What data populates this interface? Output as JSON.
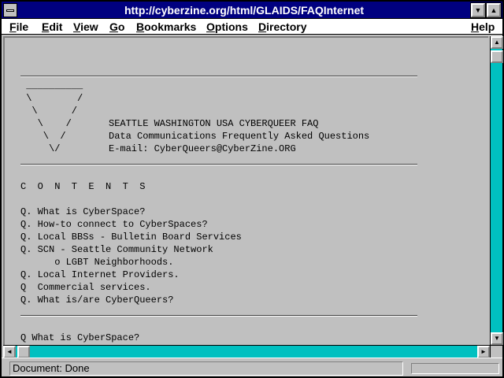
{
  "window": {
    "title": "http://cyberzine.org/html/GLAIDS/FAQInternet",
    "minimize_glyph": "▼",
    "maximize_glyph": "▲"
  },
  "menu": [
    {
      "label": "File",
      "underline": "F",
      "rest": "ile"
    },
    {
      "label": "Edit",
      "underline": "E",
      "rest": "dit"
    },
    {
      "label": "View",
      "underline": "V",
      "rest": "iew"
    },
    {
      "label": "Go",
      "underline": "G",
      "rest": "o"
    },
    {
      "label": "Bookmarks",
      "underline": "B",
      "rest": "ookmarks"
    },
    {
      "label": "Options",
      "underline": "O",
      "rest": "ptions"
    },
    {
      "label": "Directory",
      "underline": "D",
      "rest": "irectory"
    },
    {
      "label": "Help",
      "underline": "H",
      "rest": "elp"
    }
  ],
  "doc": {
    "logo_lines": [
      " __________",
      " \\        /",
      "  \\      /",
      "   \\    /",
      "    \\  /",
      "     \\/"
    ],
    "header_lines": [
      "SEATTLE WASHINGTON USA CYBERQUEER FAQ",
      "Data Communications Frequently Asked Questions",
      "E-mail: CyberQueers@CyberZine.ORG"
    ],
    "contents_heading": "C  O  N  T  E  N  T  S",
    "contents": [
      "Q. What is CyberSpace?",
      "Q. How-to connect to CyberSpaces?",
      "Q. Local BBSs - Bulletin Board Services",
      "Q. SCN - Seattle Community Network",
      "      o LGBT Neighborhoods.",
      "Q. Local Internet Providers.",
      "Q  Commercial services.",
      "Q. What is/are CyberQueers?"
    ],
    "section_heading": "Q What is CyberSpace?"
  },
  "scroll": {
    "up_glyph": "▲",
    "down_glyph": "▼",
    "left_glyph": "◄",
    "right_glyph": "►"
  },
  "status": {
    "text": "Document: Done"
  },
  "colors": {
    "titlebar": "#000080",
    "scrolltrack": "#00c0c0",
    "background": "#c0c0c0"
  }
}
